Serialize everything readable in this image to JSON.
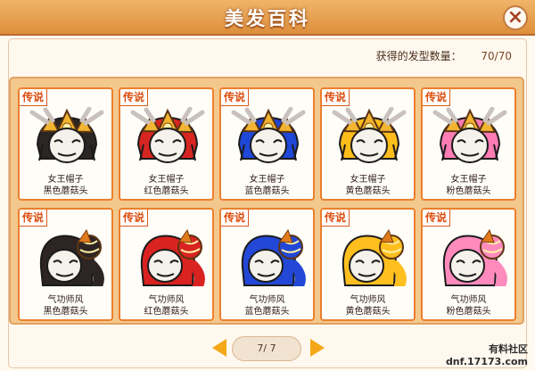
{
  "window": {
    "title": "美发百科",
    "close_icon": "close-icon"
  },
  "summary": {
    "label": "获得的发型数量：",
    "value": "70/70"
  },
  "cards": [
    {
      "badge": "传说",
      "name_line1": "女王帽子",
      "name_line2": "黑色蘑菇头",
      "color": "#2b2523",
      "type": "crown"
    },
    {
      "badge": "传说",
      "name_line1": "女王帽子",
      "name_line2": "红色蘑菇头",
      "color": "#d72521",
      "type": "crown"
    },
    {
      "badge": "传说",
      "name_line1": "女王帽子",
      "name_line2": "蓝色蘑菇头",
      "color": "#1f47d8",
      "type": "crown"
    },
    {
      "badge": "传说",
      "name_line1": "女王帽子",
      "name_line2": "黄色蘑菇头",
      "color": "#ffbd1c",
      "type": "crown"
    },
    {
      "badge": "传说",
      "name_line1": "女王帽子",
      "name_line2": "粉色蘑菇头",
      "color": "#ff7cb4",
      "type": "crown"
    },
    {
      "badge": "传说",
      "name_line1": "气功师风",
      "name_line2": "黑色蘑菇头",
      "color": "#2d2523",
      "type": "braid"
    },
    {
      "badge": "传说",
      "name_line1": "气功师风",
      "name_line2": "红色蘑菇头",
      "color": "#d92320",
      "type": "braid"
    },
    {
      "badge": "传说",
      "name_line1": "气功师风",
      "name_line2": "蓝色蘑菇头",
      "color": "#2348d7",
      "type": "braid"
    },
    {
      "badge": "传说",
      "name_line1": "气功师风",
      "name_line2": "黄色蘑菇头",
      "color": "#ffbf1f",
      "type": "braid"
    },
    {
      "badge": "传说",
      "name_line1": "气功师风",
      "name_line2": "粉色蘑菇头",
      "color": "#ff8bbd",
      "type": "braid"
    }
  ],
  "pagination": {
    "current": "7/ 7"
  },
  "watermark": {
    "line1": "有料社区",
    "line2": "dnf.17173.com"
  }
}
